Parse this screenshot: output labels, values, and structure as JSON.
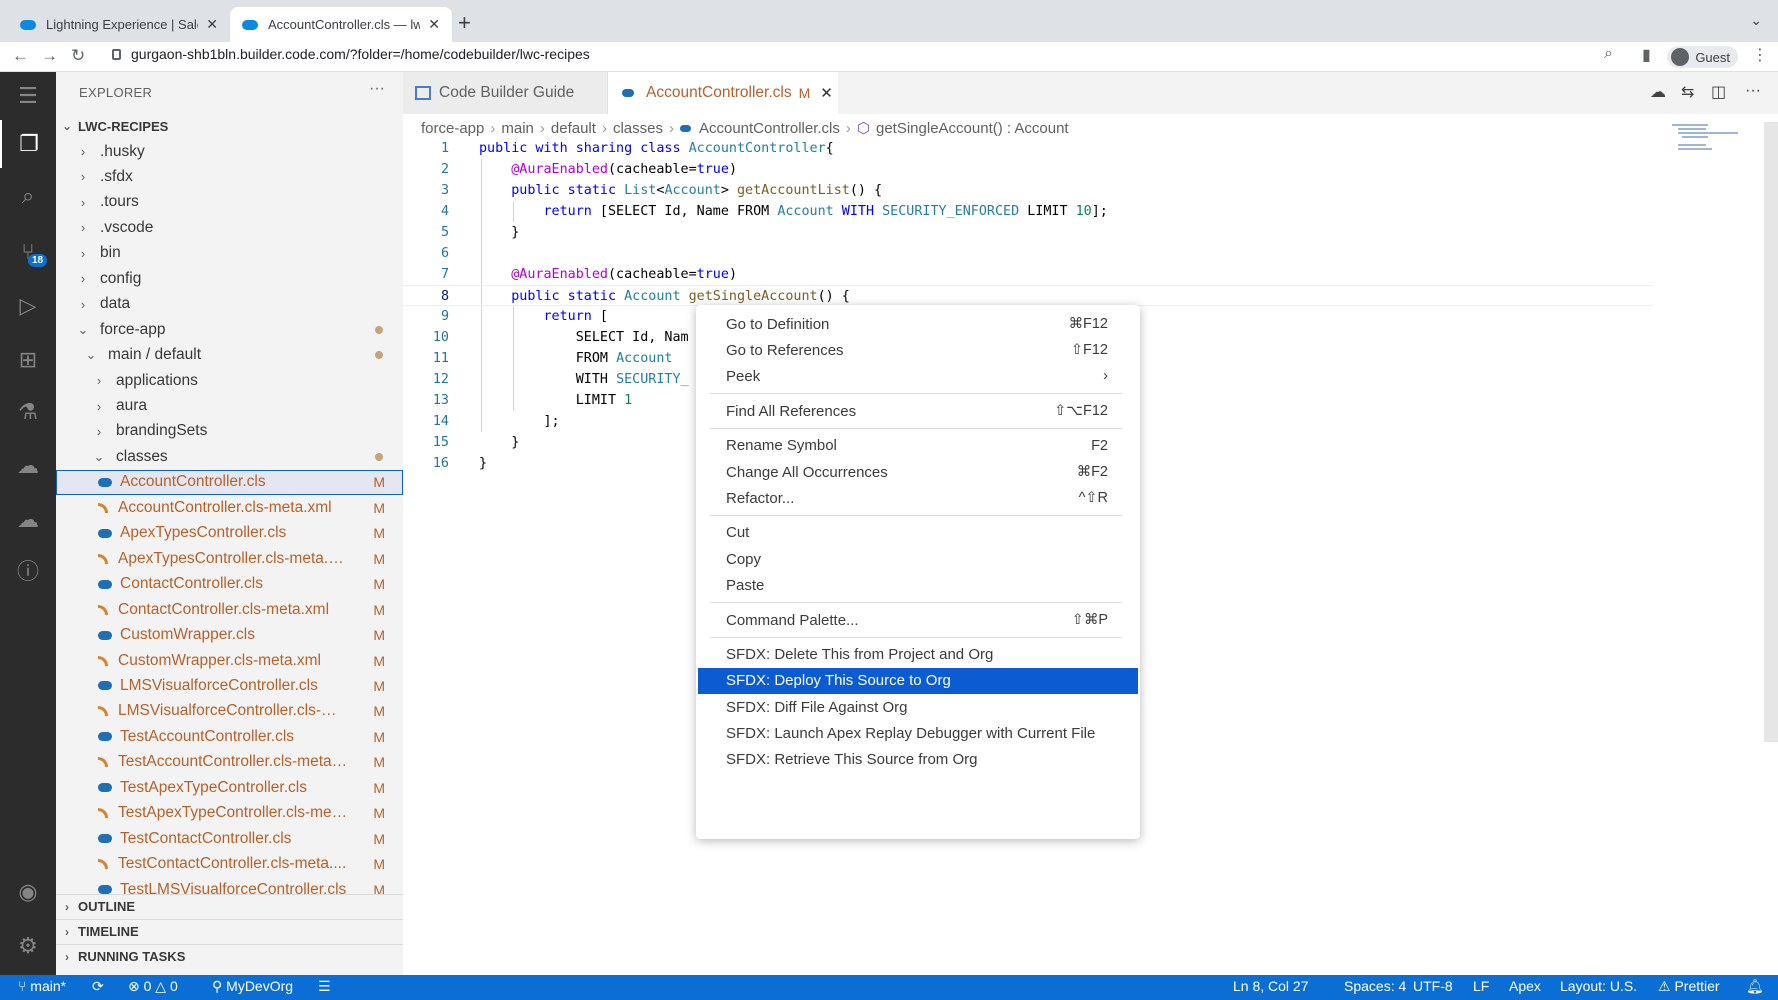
{
  "browser": {
    "tabs": [
      {
        "title": "Lightning Experience | Salesforce",
        "active": false
      },
      {
        "title": "AccountController.cls — lwc-recipes",
        "active": true
      }
    ],
    "url": "gurgaon-shb1bln.builder.code.com/?folder=/home/codebuilder/lwc-recipes",
    "profile": "Guest"
  },
  "activity_bar": {
    "source_control_badge": "18",
    "icons": [
      "explorer-icon",
      "search-icon",
      "source-control-icon",
      "run-debug-icon",
      "extensions-icon",
      "testing-icon",
      "org-browser-icon",
      "salesforce-icon",
      "problems-icon",
      "account-icon",
      "settings-icon"
    ]
  },
  "explorer": {
    "title": "EXPLORER",
    "root": "LWC-RECIPES",
    "items": [
      {
        "label": ".husky",
        "depth": 0,
        "chevron": ">"
      },
      {
        "label": ".sfdx",
        "depth": 0,
        "chevron": ">"
      },
      {
        "label": ".tours",
        "depth": 0,
        "chevron": ">"
      },
      {
        "label": ".vscode",
        "depth": 0,
        "chevron": ">"
      },
      {
        "label": "bin",
        "depth": 0,
        "chevron": ">"
      },
      {
        "label": "config",
        "depth": 0,
        "chevron": ">"
      },
      {
        "label": "data",
        "depth": 0,
        "chevron": ">"
      },
      {
        "label": "force-app",
        "depth": 0,
        "chevron": "v",
        "mod": "dot"
      },
      {
        "label": "main / default",
        "depth": 1,
        "chevron": "v",
        "mod": "dot"
      },
      {
        "label": "applications",
        "depth": 2,
        "chevron": ">"
      },
      {
        "label": "aura",
        "depth": 2,
        "chevron": ">"
      },
      {
        "label": "brandingSets",
        "depth": 2,
        "chevron": ">"
      },
      {
        "label": "classes",
        "depth": 2,
        "chevron": "v",
        "mod": "dot"
      },
      {
        "label": "AccountController.cls",
        "depth": 3,
        "icon": "cls",
        "mod": "M",
        "selected": true
      },
      {
        "label": "AccountController.cls-meta.xml",
        "depth": 3,
        "icon": "xml",
        "mod": "M"
      },
      {
        "label": "ApexTypesController.cls",
        "depth": 3,
        "icon": "cls",
        "mod": "M"
      },
      {
        "label": "ApexTypesController.cls-meta.xml",
        "depth": 3,
        "icon": "xml",
        "mod": "M"
      },
      {
        "label": "ContactController.cls",
        "depth": 3,
        "icon": "cls",
        "mod": "M"
      },
      {
        "label": "ContactController.cls-meta.xml",
        "depth": 3,
        "icon": "xml",
        "mod": "M"
      },
      {
        "label": "CustomWrapper.cls",
        "depth": 3,
        "icon": "cls",
        "mod": "M"
      },
      {
        "label": "CustomWrapper.cls-meta.xml",
        "depth": 3,
        "icon": "xml",
        "mod": "M"
      },
      {
        "label": "LMSVisualforceController.cls",
        "depth": 3,
        "icon": "cls",
        "mod": "M"
      },
      {
        "label": "LMSVisualforceController.cls-me...",
        "depth": 3,
        "icon": "xml",
        "mod": "M"
      },
      {
        "label": "TestAccountController.cls",
        "depth": 3,
        "icon": "cls",
        "mod": "M"
      },
      {
        "label": "TestAccountController.cls-meta....",
        "depth": 3,
        "icon": "xml",
        "mod": "M"
      },
      {
        "label": "TestApexTypeController.cls",
        "depth": 3,
        "icon": "cls",
        "mod": "M"
      },
      {
        "label": "TestApexTypeController.cls-met...",
        "depth": 3,
        "icon": "xml",
        "mod": "M"
      },
      {
        "label": "TestContactController.cls",
        "depth": 3,
        "icon": "cls",
        "mod": "M"
      },
      {
        "label": "TestContactController.cls-meta....",
        "depth": 3,
        "icon": "xml",
        "mod": "M"
      },
      {
        "label": "TestLMSVisualforceController.cls",
        "depth": 3,
        "icon": "cls",
        "mod": "M"
      }
    ],
    "sections": [
      "OUTLINE",
      "TIMELINE",
      "RUNNING TASKS"
    ]
  },
  "editor": {
    "tabs": [
      {
        "label": "Code Builder Guide"
      },
      {
        "label": "AccountController.cls",
        "modified": "M"
      }
    ],
    "breadcrumbs": [
      "force-app",
      "main",
      "default",
      "classes",
      "AccountController.cls",
      "getSingleAccount() : Account"
    ],
    "current_line": 8,
    "lines": [
      [
        [
          "kw",
          "public with sharing class "
        ],
        [
          "ty",
          "AccountController"
        ],
        [
          "",
          "{"
        ]
      ],
      [
        [
          "",
          "    "
        ],
        [
          "an",
          "@AuraEnabled"
        ],
        [
          "",
          "(cacheable="
        ],
        [
          "kw",
          "true"
        ],
        [
          "",
          ")"
        ]
      ],
      [
        [
          "",
          "    "
        ],
        [
          "kw",
          "public static "
        ],
        [
          "ty",
          "List"
        ],
        [
          "",
          "<"
        ],
        [
          "ty",
          "Account"
        ],
        [
          "",
          "> "
        ],
        [
          "fn",
          "getAccountList"
        ],
        [
          "",
          "() {"
        ]
      ],
      [
        [
          "",
          "        "
        ],
        [
          "kw",
          "return"
        ],
        [
          "",
          " [SELECT Id, Name FROM "
        ],
        [
          "ty",
          "Account"
        ],
        [
          "kw",
          " WITH "
        ],
        [
          "ty",
          "SECURITY_ENFORCED"
        ],
        [
          "",
          " LIMIT "
        ],
        [
          "nu",
          "10"
        ],
        [
          "",
          "];"
        ]
      ],
      [
        [
          "",
          "    }"
        ]
      ],
      [
        [
          "",
          ""
        ]
      ],
      [
        [
          "",
          "    "
        ],
        [
          "an",
          "@AuraEnabled"
        ],
        [
          "",
          "(cacheable="
        ],
        [
          "kw",
          "true"
        ],
        [
          "",
          ")"
        ]
      ],
      [
        [
          "",
          "    "
        ],
        [
          "kw",
          "public static "
        ],
        [
          "ty",
          "Account "
        ],
        [
          "fn",
          "getSingleAccount"
        ],
        [
          "",
          "() {"
        ]
      ],
      [
        [
          "",
          "        "
        ],
        [
          "kw",
          "return"
        ],
        [
          "",
          " ["
        ]
      ],
      [
        [
          "",
          "            SELECT Id, Nam"
        ]
      ],
      [
        [
          "",
          "            FROM "
        ],
        [
          "ty",
          "Account"
        ]
      ],
      [
        [
          "",
          "            WITH "
        ],
        [
          "ty",
          "SECURITY_"
        ]
      ],
      [
        [
          "",
          "            LIMIT "
        ],
        [
          "nu",
          "1"
        ]
      ],
      [
        [
          "",
          "        ];"
        ]
      ],
      [
        [
          "",
          "    }"
        ]
      ],
      [
        [
          "",
          "}"
        ]
      ]
    ]
  },
  "context_menu": {
    "groups": [
      [
        {
          "label": "Go to Definition",
          "shortcut": "⌘F12"
        },
        {
          "label": "Go to References",
          "shortcut": "⇧F12"
        },
        {
          "label": "Peek",
          "shortcut": "›"
        }
      ],
      [
        {
          "label": "Find All References",
          "shortcut": "⇧⌥F12"
        }
      ],
      [
        {
          "label": "Rename Symbol",
          "shortcut": "F2"
        },
        {
          "label": "Change All Occurrences",
          "shortcut": "⌘F2"
        },
        {
          "label": "Refactor...",
          "shortcut": "^⇧R"
        }
      ],
      [
        {
          "label": "Cut",
          "shortcut": ""
        },
        {
          "label": "Copy",
          "shortcut": ""
        },
        {
          "label": "Paste",
          "shortcut": ""
        }
      ],
      [
        {
          "label": "Command Palette...",
          "shortcut": "⇧⌘P"
        }
      ],
      [
        {
          "label": "SFDX: Delete This from Project and Org",
          "shortcut": ""
        },
        {
          "label": "SFDX: Deploy This Source to Org",
          "shortcut": "",
          "highlighted": true
        },
        {
          "label": "SFDX: Diff File Against Org",
          "shortcut": ""
        },
        {
          "label": "SFDX: Launch Apex Replay Debugger with Current File",
          "shortcut": ""
        },
        {
          "label": "SFDX: Retrieve This Source from Org",
          "shortcut": ""
        }
      ]
    ]
  },
  "status_bar": {
    "branch": "main*",
    "errors": "0",
    "warnings": "0",
    "org": "MyDevOrg",
    "cursor": "Ln 8, Col 27",
    "indent": "Spaces: 4",
    "encoding": "UTF-8",
    "eol": "LF",
    "language": "Apex",
    "layout": "Layout: U.S.",
    "formatter": "Prettier"
  }
}
